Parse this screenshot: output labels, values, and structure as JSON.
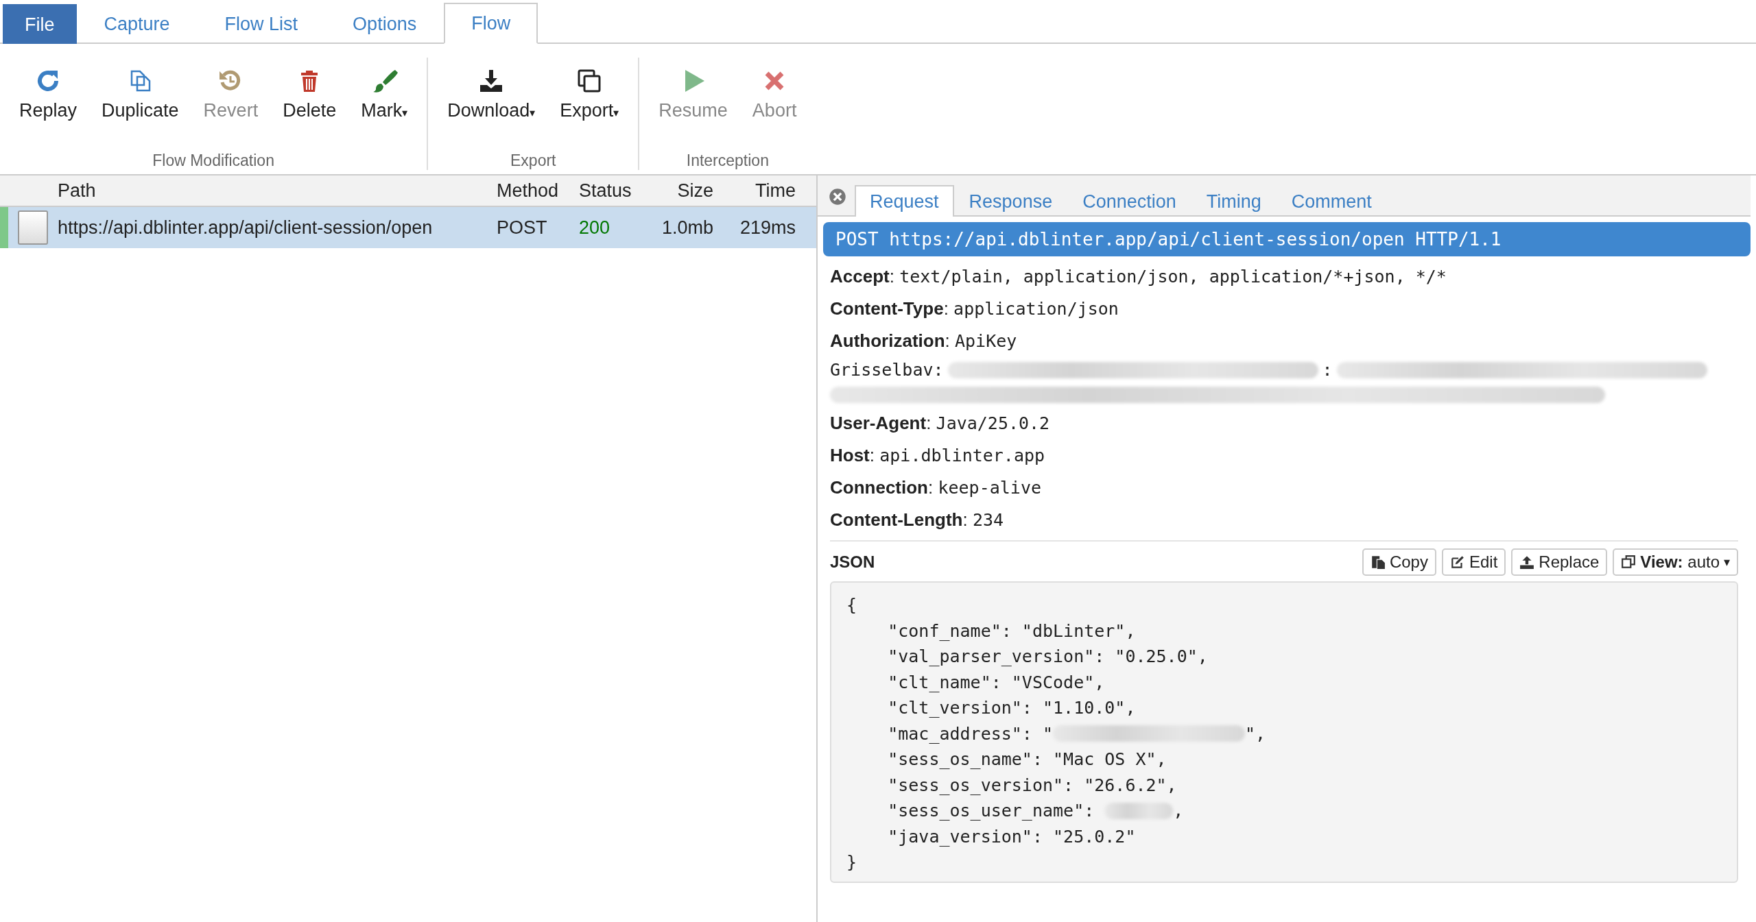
{
  "menu_tabs": [
    {
      "label": "File",
      "kind": "file",
      "selected": false
    },
    {
      "label": "Capture",
      "kind": "tab",
      "selected": false
    },
    {
      "label": "Flow List",
      "kind": "tab",
      "selected": false
    },
    {
      "label": "Options",
      "kind": "tab",
      "selected": false
    },
    {
      "label": "Flow",
      "kind": "tab",
      "selected": true
    }
  ],
  "ribbon": [
    {
      "title": "Flow Modification",
      "buttons": [
        {
          "label": "Replay",
          "kind": "replay",
          "disabled": false
        },
        {
          "label": "Duplicate",
          "kind": "duplicate",
          "disabled": false
        },
        {
          "label": "Revert",
          "kind": "revert",
          "disabled": true
        },
        {
          "label": "Delete",
          "kind": "delete",
          "disabled": false
        },
        {
          "label": "Mark",
          "kind": "mark",
          "disabled": false,
          "caret": "▾"
        }
      ]
    },
    {
      "title": "Export",
      "buttons": [
        {
          "label": "Download",
          "kind": "download",
          "disabled": false,
          "caret": "▾"
        },
        {
          "label": "Export",
          "kind": "export",
          "disabled": false,
          "caret": "▾"
        }
      ]
    },
    {
      "title": "Interception",
      "buttons": [
        {
          "label": "Resume",
          "kind": "resume",
          "disabled": true
        },
        {
          "label": "Abort",
          "kind": "abort",
          "disabled": true
        }
      ]
    }
  ],
  "flow_table": {
    "columns": [
      "Path",
      "Method",
      "Status",
      "Size",
      "Time"
    ],
    "rows": [
      {
        "selected": true,
        "tls": true,
        "path": "https://api.dblinter.app/api/client-session/open",
        "method": "POST",
        "status": "200",
        "size": "1.0mb",
        "time": "219ms"
      }
    ]
  },
  "detail": {
    "tabs": [
      {
        "label": "Request",
        "selected": true
      },
      {
        "label": "Response",
        "selected": false
      },
      {
        "label": "Connection",
        "selected": false
      },
      {
        "label": "Timing",
        "selected": false
      },
      {
        "label": "Comment",
        "selected": false
      }
    ],
    "request_line": "POST https://api.dblinter.app/api/client-session/open HTTP/1.1",
    "headers": [
      {
        "name": "**Accept**:",
        "value": "text/plain, application/json, application/*+json, */*"
      },
      {
        "name": "**Content-Type**:",
        "value": "application/json"
      },
      {
        "name": "**Authorization**:",
        "value": "ApiKey",
        "continuation": [
          [
            {
              "kind": "text",
              "text": "Grisselbav:"
            },
            {
              "kind": "redacted"
            },
            {
              "kind": "text",
              "text": ":"
            },
            {
              "kind": "redacted"
            }
          ],
          [
            {
              "kind": "redacted"
            }
          ]
        ]
      },
      {
        "name": "**User-Agent**:",
        "value": "Java/25.0.2"
      },
      {
        "name": "**Host**:",
        "value": "api.dblinter.app"
      },
      {
        "name": "**Connection**:",
        "value": "keep-alive"
      },
      {
        "name": "**Content-Length**:",
        "value": "234"
      }
    ],
    "content": {
      "title": "JSON",
      "buttons": [
        {
          "label": "Copy",
          "kind": "copy"
        },
        {
          "label": "Edit",
          "kind": "edit"
        },
        {
          "label": "Replace",
          "kind": "upload"
        },
        {
          "label": "**View:** auto",
          "kind": "view",
          "caret": "▾"
        }
      ],
      "lines": [
        [
          {
            "kind": "text",
            "text": "{"
          }
        ],
        [
          {
            "kind": "text",
            "text": "    \"conf_name\": \"dbLinter\","
          }
        ],
        [
          {
            "kind": "text",
            "text": "    \"val_parser_version\": \"0.25.0\","
          }
        ],
        [
          {
            "kind": "text",
            "text": "    \"clt_name\": \"VSCode\","
          }
        ],
        [
          {
            "kind": "text",
            "text": "    \"clt_version\": \"1.10.0\","
          }
        ],
        [
          {
            "kind": "text",
            "text": "    \"mac_address\": \""
          },
          {
            "kind": "redacted"
          },
          {
            "kind": "text",
            "text": "\","
          }
        ],
        [
          {
            "kind": "text",
            "text": "    \"sess_os_name\": \"Mac OS X\","
          }
        ],
        [
          {
            "kind": "text",
            "text": "    \"sess_os_version\": \"26.6.2\","
          }
        ],
        [
          {
            "kind": "text",
            "text": "    \"sess_os_user_name\": "
          },
          {
            "kind": "redacted"
          },
          {
            "kind": "text",
            "text": ","
          }
        ],
        [
          {
            "kind": "text",
            "text": "    \"java_version\": \"25.0.2\""
          }
        ],
        [
          {
            "kind": "text",
            "text": "}"
          }
        ]
      ]
    }
  }
}
